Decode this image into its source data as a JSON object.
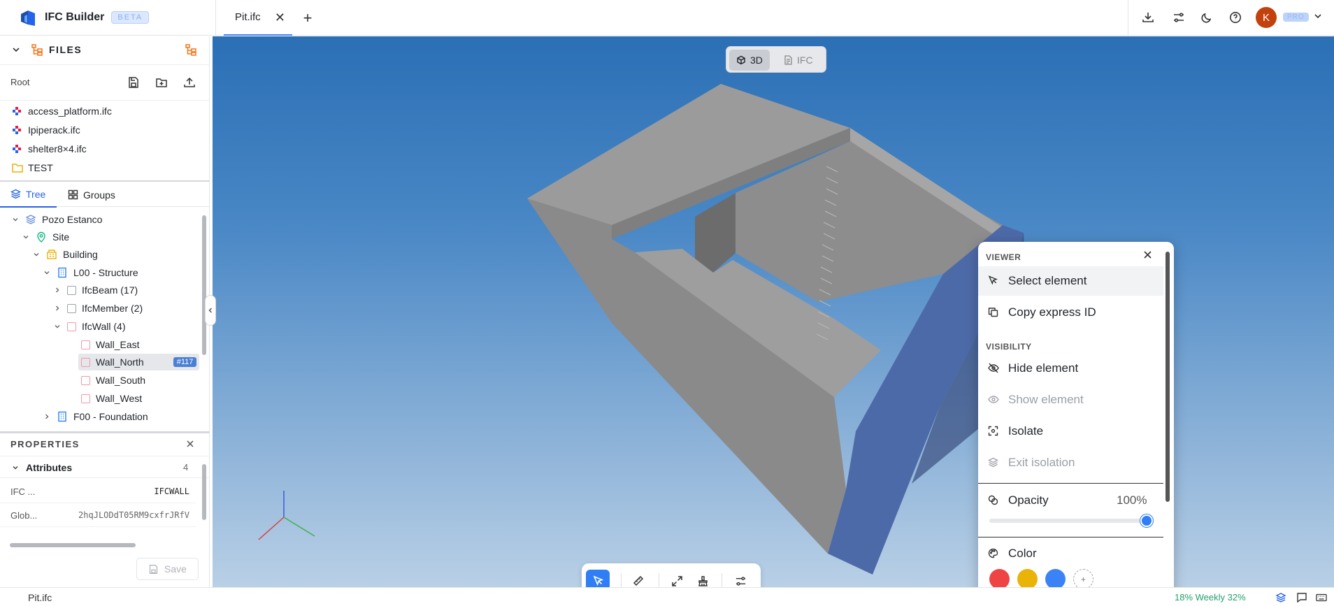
{
  "app": {
    "title": "IFC Builder",
    "beta_label": "BETA",
    "pro_label": "PRO",
    "avatar_initial": "K"
  },
  "tabs": [
    {
      "label": "Pit.ifc"
    }
  ],
  "files": {
    "section_title": "FILES",
    "root_label": "Root",
    "items": [
      {
        "name": "access_platform.ifc",
        "type": "ifc"
      },
      {
        "name": "Ipiperack.ifc",
        "type": "ifc"
      },
      {
        "name": "shelter8×4.ifc",
        "type": "ifc"
      },
      {
        "name": "TEST",
        "type": "folder"
      }
    ]
  },
  "tree_tabs": {
    "tree": "Tree",
    "groups": "Groups"
  },
  "tree": {
    "project": "Pozo Estanco",
    "site": "Site",
    "building": "Building",
    "storey": "L00 - Structure",
    "groups": [
      {
        "label": "IfcBeam (17)"
      },
      {
        "label": "IfcMember (2)"
      },
      {
        "label": "IfcWall (4)"
      }
    ],
    "walls": [
      {
        "label": "Wall_East"
      },
      {
        "label": "Wall_North",
        "badge": "#117"
      },
      {
        "label": "Wall_South"
      },
      {
        "label": "Wall_West"
      }
    ],
    "foundation": "F00 - Foundation"
  },
  "properties": {
    "title": "PROPERTIES",
    "attributes_label": "Attributes",
    "attributes_count": "4",
    "rows": [
      {
        "key": "IFC ...",
        "value": "IFCWALL"
      },
      {
        "key": "Glob...",
        "value": "2hqJLODdT05RM9cxfrJRfV"
      }
    ],
    "save_label": "Save"
  },
  "viewer": {
    "modes": {
      "mode_3d": "3D",
      "mode_ifc": "IFC"
    }
  },
  "context_menu": {
    "viewer_section": "VIEWER",
    "select_element": "Select element",
    "copy_express_id": "Copy express ID",
    "visibility_section": "VISIBILITY",
    "hide_element": "Hide element",
    "show_element": "Show element",
    "isolate": "Isolate",
    "exit_isolation": "Exit isolation",
    "opacity_label": "Opacity",
    "opacity_value": "100%",
    "opacity_level": 1.0,
    "color_label": "Color",
    "swatches": [
      "#ef4444",
      "#eab308",
      "#3b82f6"
    ],
    "add_swatch": "+"
  },
  "statusbar": {
    "file": "Pit.ifc",
    "usage": "18%  Weekly 32%"
  },
  "colors": {
    "accent": "#2f7ef5",
    "brand_orange": "#f97316",
    "avatar": "#c2410c"
  }
}
